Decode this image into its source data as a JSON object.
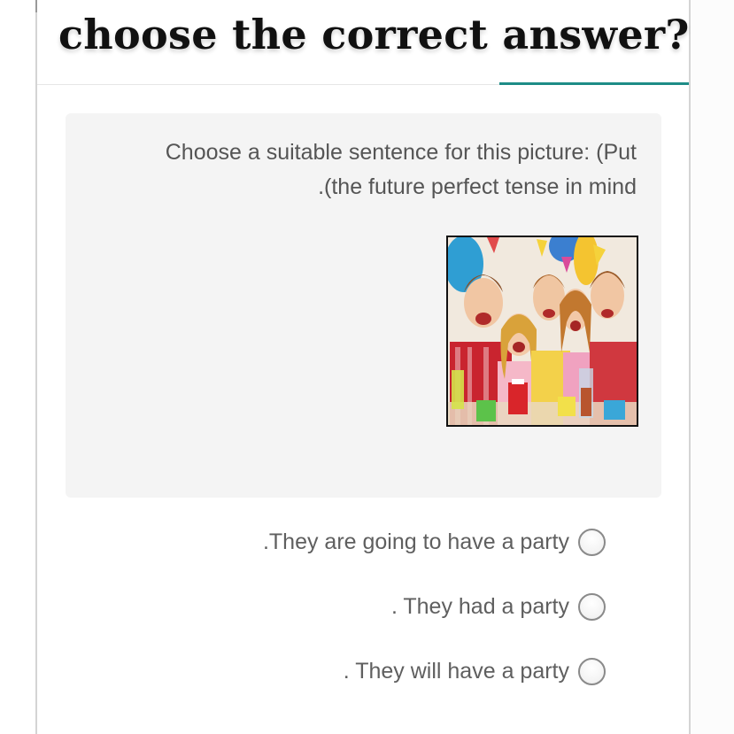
{
  "question": {
    "title": "choose the correct answer?",
    "prompt_line1": "Choose a suitable sentence for this picture: (Put",
    "prompt_line2": ".(the future perfect tense in mind"
  },
  "options": [
    {
      "label": ".They are going to have a party",
      "selected": false
    },
    {
      "label": ". They had a party",
      "selected": false
    },
    {
      "label": ". They will have a party",
      "selected": false
    }
  ],
  "colors": {
    "accent": "#1e8c87",
    "card_background": "#f4f4f4",
    "text": "#5f5f5f",
    "title": "#111111"
  }
}
